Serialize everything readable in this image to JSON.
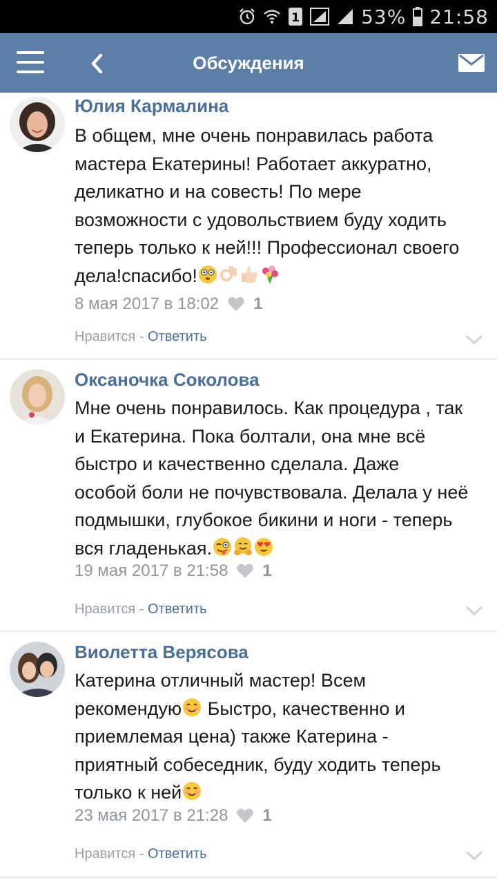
{
  "status_bar": {
    "icons": [
      "alarm-icon",
      "wifi-icon",
      "sim-icon",
      "signal-icon",
      "signal-icon",
      "battery-icon"
    ],
    "battery": "53%",
    "time": "21:58"
  },
  "app_bar": {
    "title": "Обсуждения",
    "menu_icon": "hamburger-icon",
    "back_icon": "chevron-left-icon",
    "mail_icon": "envelope-icon"
  },
  "colors": {
    "app_bar": "#5b7fa6",
    "author": "#4a6f98",
    "meta": "#8f969e",
    "divider": "#e4e6e9"
  },
  "comments": [
    {
      "author": "Юлия Кармалина",
      "lines": [
        "В общем, мне очень понравилась работа",
        "мастера Екатерины! Работает аккуратно,",
        "деликатно и на совесть! По мере",
        "возможности с удовольствием буду ходить",
        "теперь только к ней!!! Профессионал своего",
        "дела!спасибо!"
      ],
      "emojis": [
        "flushed-face-emoji",
        "ok-hand-emoji",
        "thumbs-up-emoji",
        "bouquet-emoji"
      ],
      "date": "8 мая 2017 в 18:02",
      "likes": "1",
      "like_label": "Нравится",
      "separator": " - ",
      "reply_label": "Ответить"
    },
    {
      "author": "Оксаночка Соколова",
      "lines": [
        "Мне очень понравилось. Как процедура , так",
        "и Екатерина. Пока болтали, она мне всё",
        "быстро и качественно сделала. Даже",
        "особой боли не почувствовала. Делала у неё",
        "подмышки, глубокое бикини и ноги - теперь",
        "вся гладенькая."
      ],
      "emojis": [
        "winking-tongue-emoji",
        "hugging-face-emoji",
        "heart-eyes-emoji"
      ],
      "date": "19 мая 2017 в 21:58",
      "likes": "1",
      "like_label": "Нравится",
      "separator": " - ",
      "reply_label": "Ответить"
    },
    {
      "author": "Виолетта Верясова",
      "lines": [
        "Катерина отличный мастер! Всем",
        "рекомендую",
        "приемлемая цена) также Катерина -",
        "приятный собеседник, буду ходить теперь",
        "только к ней"
      ],
      "line2_suffix": " Быстро, качественно и",
      "emojis": [
        "smiling-face-emoji"
      ],
      "date": "23 мая 2017 в 21:28",
      "likes": "1",
      "like_label": "Нравится",
      "separator": " - ",
      "reply_label": "Ответить"
    }
  ]
}
